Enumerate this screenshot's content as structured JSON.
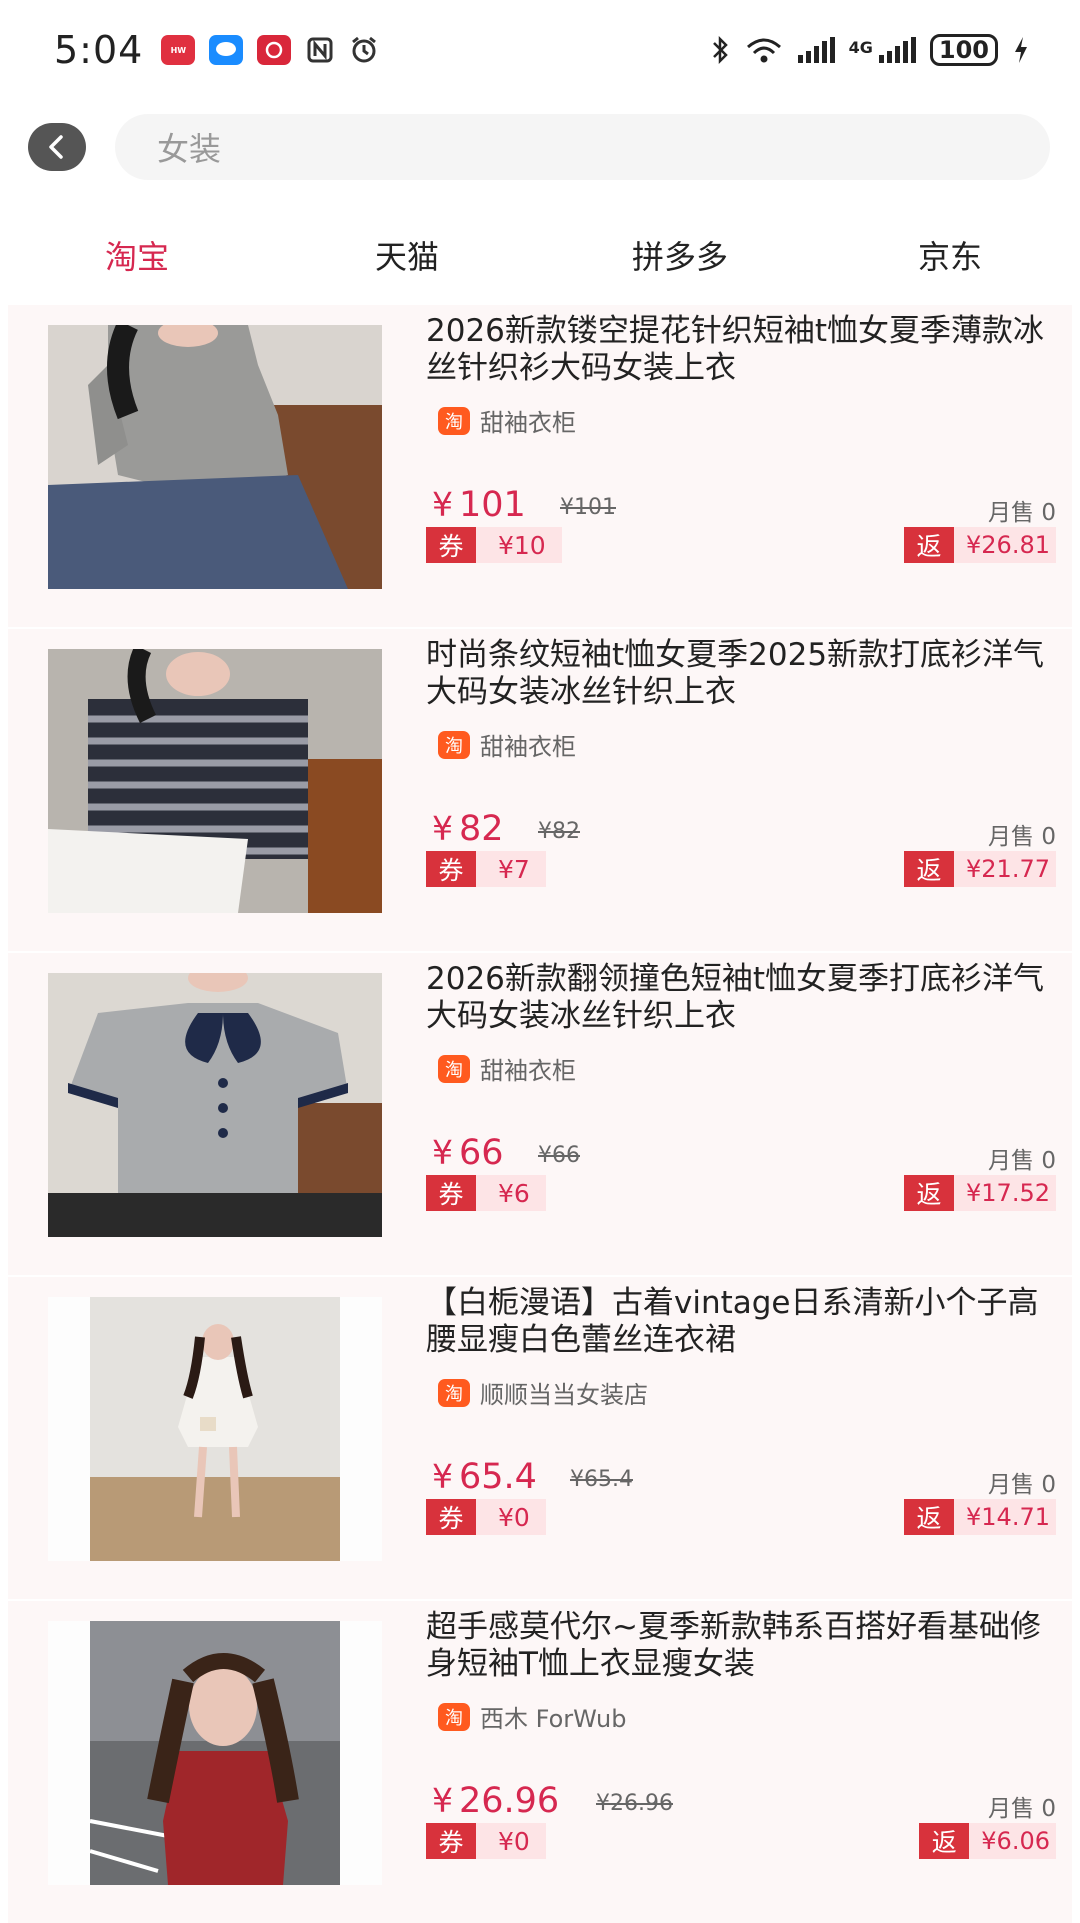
{
  "status_bar": {
    "time": "5:04",
    "notif_icons": [
      "huawei-app-icon",
      "message-icon",
      "app-icon",
      "nfc-icon",
      "alarm-icon"
    ],
    "network": "4G",
    "battery": "100"
  },
  "search": {
    "query": "女装"
  },
  "tabs": [
    {
      "label": "淘宝",
      "active": true
    },
    {
      "label": "天猫",
      "active": false
    },
    {
      "label": "拼多多",
      "active": false
    },
    {
      "label": "京东",
      "active": false
    }
  ],
  "products": [
    {
      "title": "2026新款镂空提花针织短袖t恤女夏季薄款冰丝针织衫大码女装上衣",
      "shop_logo": "淘",
      "shop": "甜袖衣柜",
      "yen": "¥",
      "price": "101",
      "original": "¥101",
      "sales": "月售 0",
      "coupon_tag": "券",
      "coupon": "¥10",
      "rebate_tag": "返",
      "rebate": "¥26.81"
    },
    {
      "title": "时尚条纹短袖t恤女夏季2025新款打底衫洋气大码女装冰丝针织上衣",
      "shop_logo": "淘",
      "shop": "甜袖衣柜",
      "yen": "¥",
      "price": "82",
      "original": "¥82",
      "sales": "月售 0",
      "coupon_tag": "券",
      "coupon": "¥7",
      "rebate_tag": "返",
      "rebate": "¥21.77"
    },
    {
      "title": "2026新款翻领撞色短袖t恤女夏季打底衫洋气大码女装冰丝针织上衣",
      "shop_logo": "淘",
      "shop": "甜袖衣柜",
      "yen": "¥",
      "price": "66",
      "original": "¥66",
      "sales": "月售 0",
      "coupon_tag": "券",
      "coupon": "¥6",
      "rebate_tag": "返",
      "rebate": "¥17.52"
    },
    {
      "title": "【白栀漫语】古着vintage日系清新小个子高腰显瘦白色蕾丝连衣裙",
      "shop_logo": "淘",
      "shop": "顺顺当当女装店",
      "yen": "¥",
      "price": "65.4",
      "original": "¥65.4",
      "sales": "月售 0",
      "coupon_tag": "券",
      "coupon": "¥0",
      "rebate_tag": "返",
      "rebate": "¥14.71"
    },
    {
      "title": "超手感莫代尔~夏季新款韩系百搭好看基础修身短袖T恤上衣显瘦女装",
      "shop_logo": "淘",
      "shop": "西木 ForWub",
      "yen": "¥",
      "price": "26.96",
      "original": "¥26.96",
      "sales": "月售 0",
      "coupon_tag": "券",
      "coupon": "¥0",
      "rebate_tag": "返",
      "rebate": "¥6.06"
    }
  ]
}
